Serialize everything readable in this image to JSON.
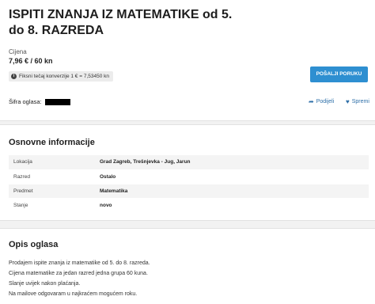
{
  "listing": {
    "title": "ISPITI ZNANJA IZ MATEMATIKE od 5. do 8. RAZREDA",
    "price_label": "Cijena",
    "price": "7,96 € / 60 kn",
    "conversion_note": "Fiksni tečaj konverzije 1 € = 7,53450 kn",
    "send_button": "POŠALJI PORUKU",
    "code_label": "Šifra oglasa:",
    "share_label": "Podijeli",
    "save_label": "Spremi"
  },
  "info": {
    "title": "Osnovne informacije",
    "rows": [
      {
        "key": "Lokacija",
        "value": "Grad Zagreb, Trešnjevka - Jug, Jarun"
      },
      {
        "key": "Razred",
        "value": "Ostalo"
      },
      {
        "key": "Predmet",
        "value": "Matematika"
      },
      {
        "key": "Stanje",
        "value": "novo"
      }
    ]
  },
  "description": {
    "title": "Opis oglasa",
    "lines": [
      "Prodajem ispite znanja iz matematike od 5. do 8. razreda.",
      "Cijena matematike za jedan razred jedna grupa 60 kuna.",
      "Slanje uvijek nakon plaćanja.",
      "Na mailove odgovaram u najkraćem mogućem roku."
    ]
  },
  "colors": {
    "accent": "#2e8fd1",
    "link": "#2e6fa8",
    "background": "#f2f2f2"
  },
  "icons": {
    "conversion": "info-icon",
    "share": "share-icon",
    "save": "heart-icon"
  }
}
